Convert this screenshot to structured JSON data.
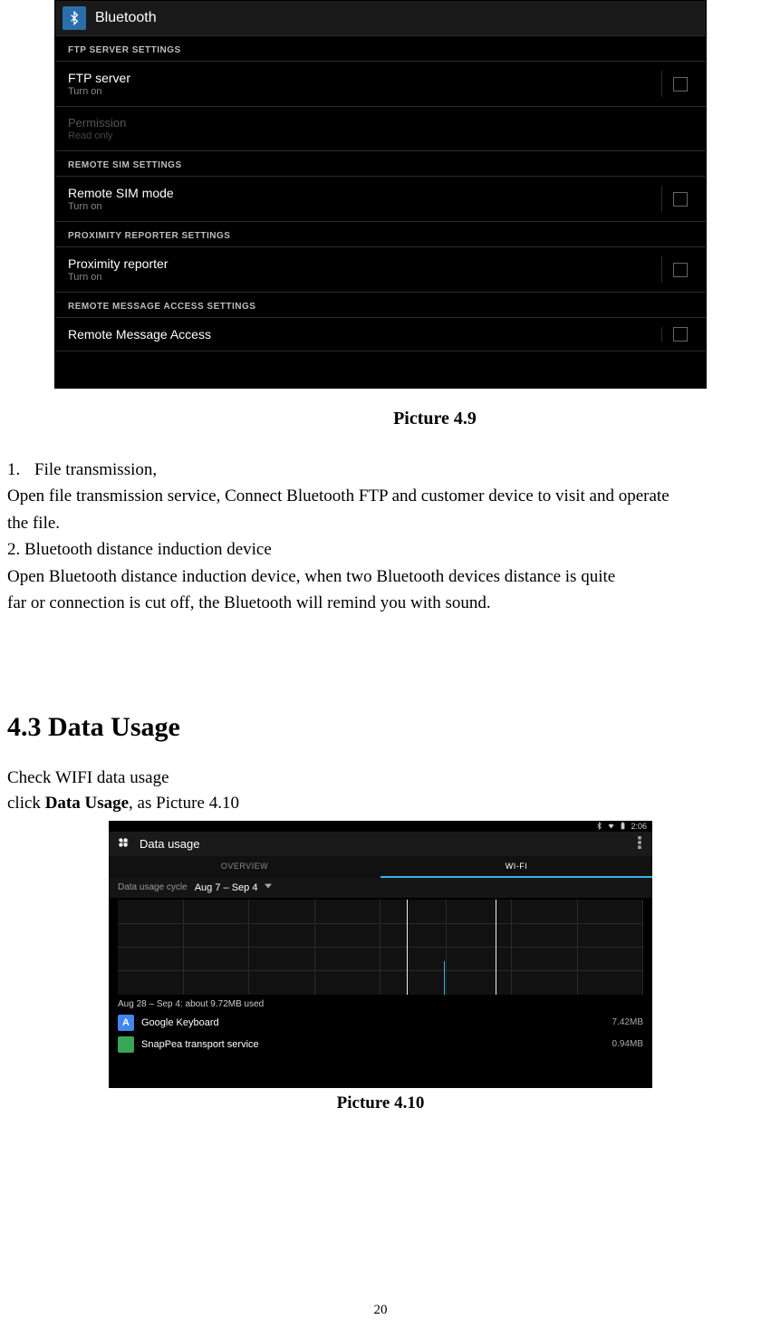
{
  "bt": {
    "title": "Bluetooth",
    "sections": [
      {
        "header": "FTP SERVER SETTINGS",
        "rows": [
          {
            "title": "FTP server",
            "sub": "Turn on",
            "checkbox": true,
            "disabled": false
          },
          {
            "title": "Permission",
            "sub": "Read only",
            "checkbox": false,
            "disabled": true
          }
        ]
      },
      {
        "header": "REMOTE SIM SETTINGS",
        "rows": [
          {
            "title": "Remote SIM mode",
            "sub": "Turn on",
            "checkbox": true,
            "disabled": false
          }
        ]
      },
      {
        "header": "PROXIMITY REPORTER SETTINGS",
        "rows": [
          {
            "title": "Proximity reporter",
            "sub": "Turn on",
            "checkbox": true,
            "disabled": false
          }
        ]
      },
      {
        "header": "REMOTE MESSAGE ACCESS SETTINGS",
        "rows": [
          {
            "title": "Remote Message Access",
            "sub": "",
            "checkbox": true,
            "disabled": false
          }
        ]
      }
    ]
  },
  "caption1": "Picture 4.9",
  "body": {
    "item1_num": "1.",
    "item1_title": "File transmission,",
    "item1_text1": "Open file transmission service, Connect Bluetooth FTP and customer device to visit and operate",
    "item1_text2": "the file.",
    "item2_title": "2. Bluetooth distance induction device",
    "item2_text1": "Open Bluetooth distance induction device, when two Bluetooth devices distance is quite",
    "item2_text2": "far or connection is cut off, the Bluetooth will remind you with sound."
  },
  "heading": "4.3 Data Usage",
  "sub1": "Check WIFI data usage",
  "sub2_a": "click ",
  "sub2_b": "Data Usage",
  "sub2_c": ", as Picture 4.10",
  "du": {
    "time": "2:06",
    "title": "Data usage",
    "tab1": "OVERVIEW",
    "tab2": "WI-FI",
    "cycle_label": "Data usage cycle",
    "cycle_value": "Aug 7 – Sep 4",
    "range_text": "Aug 28 – Sep 4: about 9.72MB used",
    "apps": [
      {
        "name": "Google Keyboard",
        "size": "7.42MB",
        "iconBg": "#4285f4",
        "iconLetter": "A"
      },
      {
        "name": "SnapPea transport service",
        "size": "0.94MB",
        "iconBg": "#3aa655",
        "iconLetter": ""
      }
    ]
  },
  "caption2": "Picture 4.10",
  "pageNum": "20"
}
